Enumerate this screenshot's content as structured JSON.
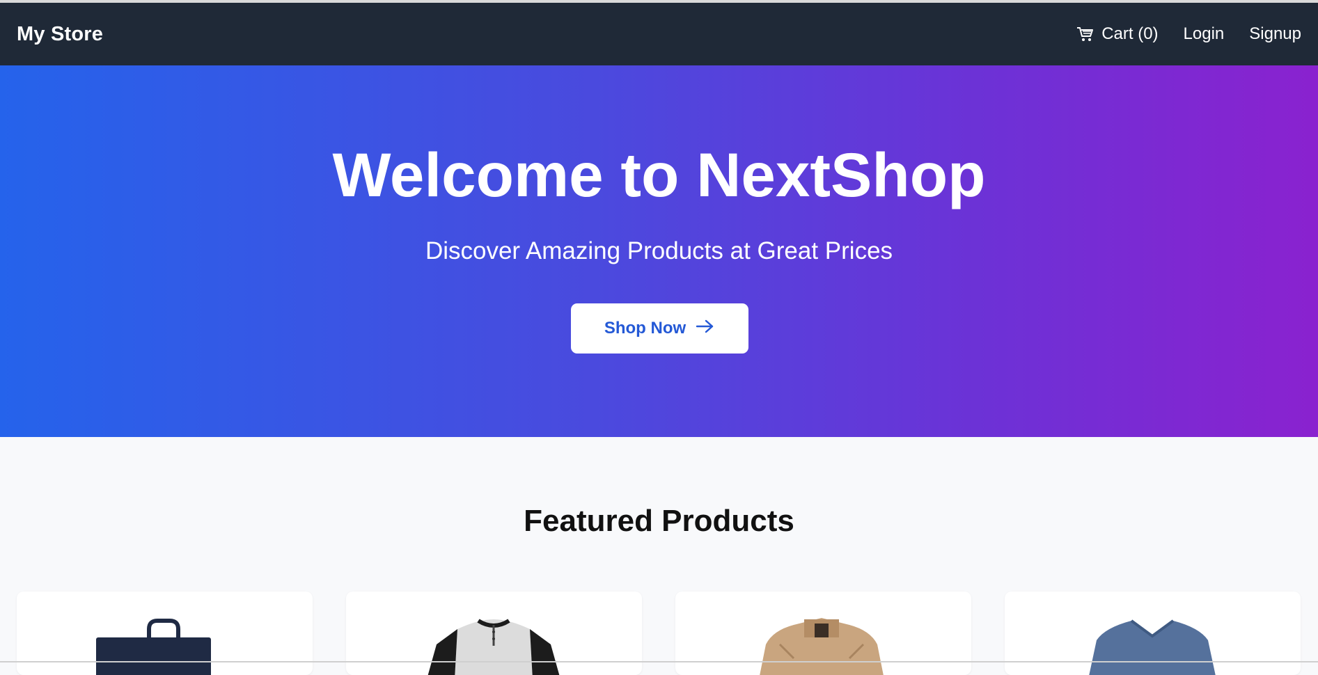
{
  "navbar": {
    "brand": "My Store",
    "cart_label": "Cart (0)",
    "login_label": "Login",
    "signup_label": "Signup",
    "background_color": "#1f2937"
  },
  "hero": {
    "title": "Welcome to NextShop",
    "subtitle": "Discover Amazing Products at Great Prices",
    "button_label": "Shop Now",
    "gradient_start": "#2563eb",
    "gradient_end": "#8a22cf"
  },
  "featured": {
    "title": "Featured Products",
    "products": [
      {
        "image": "navy-tote-bag"
      },
      {
        "image": "raglan-henley-shirt"
      },
      {
        "image": "beige-jacket"
      },
      {
        "image": "blue-vneck-tshirt"
      }
    ]
  },
  "icons": {
    "cart": "cart-icon",
    "arrow": "arrow-right-icon"
  }
}
